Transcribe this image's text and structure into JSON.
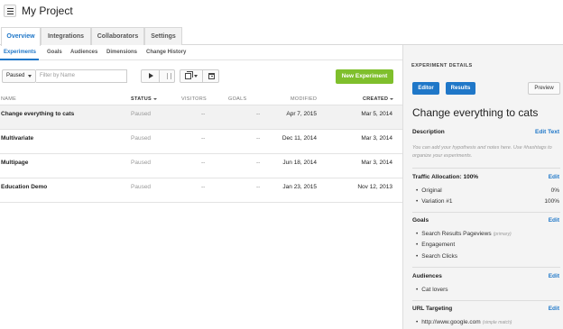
{
  "header": {
    "title": "My Project"
  },
  "tabs": [
    "Overview",
    "Integrations",
    "Collaborators",
    "Settings"
  ],
  "subtabs": [
    "Experiments",
    "Goals",
    "Audiences",
    "Dimensions",
    "Change History"
  ],
  "toolbar": {
    "status_value": "Paused",
    "filter_placeholder": "Filter by Name",
    "new_button": "New Experiment"
  },
  "table": {
    "columns": [
      "NAME",
      "STATUS",
      "VISITORS",
      "GOALS",
      "MODIFIED",
      "CREATED"
    ],
    "rows": [
      {
        "name": "Change everything to cats",
        "status": "Paused",
        "visitors": "--",
        "goals": "--",
        "modified": "Apr 7, 2015",
        "created": "Mar 5, 2014"
      },
      {
        "name": "Multivariate",
        "status": "Paused",
        "visitors": "--",
        "goals": "--",
        "modified": "Dec 11, 2014",
        "created": "Mar 3, 2014"
      },
      {
        "name": "Multipage",
        "status": "Paused",
        "visitors": "--",
        "goals": "--",
        "modified": "Jun 18, 2014",
        "created": "Mar 3, 2014"
      },
      {
        "name": "Education Demo",
        "status": "Paused",
        "visitors": "--",
        "goals": "--",
        "modified": "Jan 23, 2015",
        "created": "Nov 12, 2013"
      }
    ]
  },
  "panel": {
    "title": "EXPERIMENT DETAILS",
    "editor_button": "Editor",
    "results_button": "Results",
    "preview_button": "Preview",
    "experiment_name": "Change everything to cats",
    "description_label": "Description",
    "edit_text_label": "Edit Text",
    "description_text": "You can add your hypothesis and notes here. Use #hashtags to organize your experiments.",
    "traffic_label": "Traffic Allocation: 100%",
    "edit_label": "Edit",
    "traffic_items": [
      {
        "name": "Original",
        "pct": "0%"
      },
      {
        "name": "Variation #1",
        "pct": "100%"
      }
    ],
    "goals_label": "Goals",
    "goals": [
      {
        "name": "Search Results Pageviews",
        "note": "(primary)"
      },
      {
        "name": "Engagement",
        "note": ""
      },
      {
        "name": "Search Clicks",
        "note": ""
      }
    ],
    "audiences_label": "Audiences",
    "audiences": [
      "Cat lovers"
    ],
    "url_label": "URL Targeting",
    "urls": [
      {
        "url": "http://www.google.com",
        "note": "(simple match)"
      }
    ]
  },
  "colors": {
    "accent": "#1f77c8",
    "new_button": "#7fbf2c"
  }
}
